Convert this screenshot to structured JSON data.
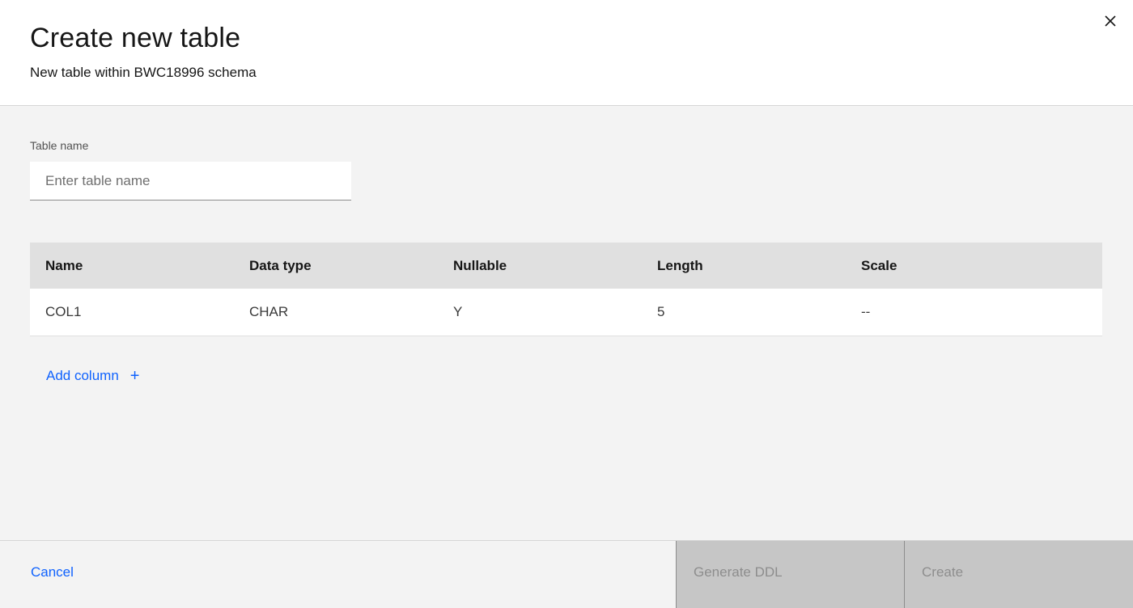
{
  "header": {
    "title": "Create new table",
    "subtitle": "New table within BWC18996 schema",
    "close_icon": "close-icon"
  },
  "form": {
    "table_name_label": "Table name",
    "table_name_placeholder": "Enter table name",
    "table_name_value": ""
  },
  "columns_table": {
    "headers": [
      "Name",
      "Data type",
      "Nullable",
      "Length",
      "Scale"
    ],
    "rows": [
      [
        "COL1",
        "CHAR",
        "Y",
        "5",
        "--"
      ]
    ]
  },
  "add_column": {
    "label": "Add column",
    "icon": "+"
  },
  "footer": {
    "cancel_label": "Cancel",
    "generate_ddl_label": "Generate DDL",
    "create_label": "Create"
  },
  "colors": {
    "link": "#0f62fe",
    "disabled_button_bg": "#c6c6c6",
    "disabled_button_text": "#8d8d8d",
    "table_header_bg": "#e0e0e0",
    "page_bg": "#f3f3f3"
  }
}
